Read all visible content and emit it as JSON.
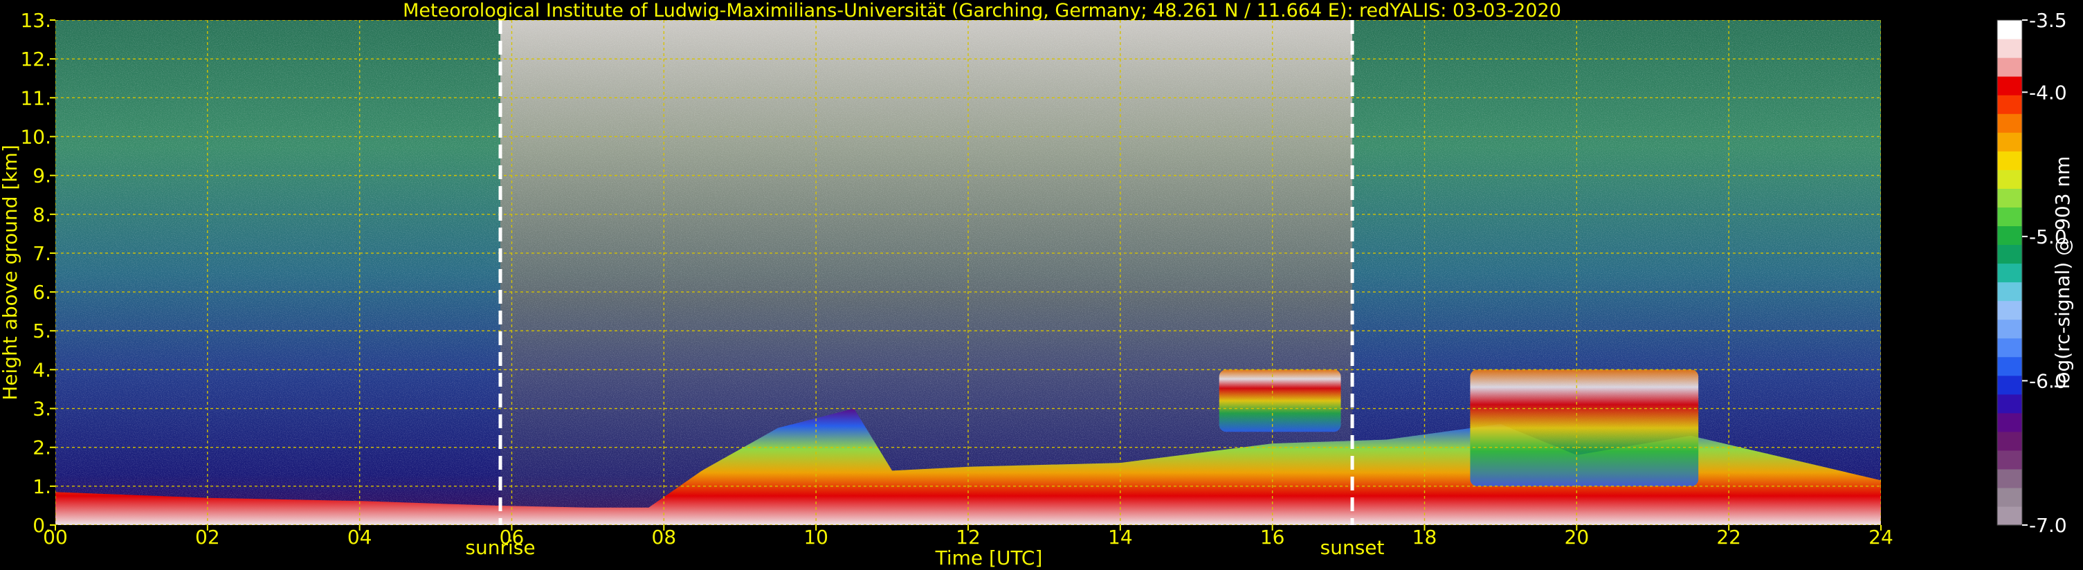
{
  "colors": {
    "background": "#000000",
    "text_yellow": "#f5f500",
    "grid": "#d6c200",
    "marker_line": "#ffffff"
  },
  "chart_data": {
    "type": "heatmap",
    "title": "Meteorological Institute of Ludwig-Maximilians-Universität (Garching, Germany; 48.261 N / 11.664 E):    redYALIS: 03-03-2020",
    "xlabel": "Time [UTC]",
    "ylabel": "Height above ground [km]",
    "xlim": [
      0,
      24
    ],
    "ylim": [
      0,
      13
    ],
    "xticks": [
      0,
      2,
      4,
      6,
      8,
      10,
      12,
      14,
      16,
      18,
      20,
      22,
      24
    ],
    "xtick_labels": [
      "00",
      "02",
      "04",
      "06",
      "08",
      "10",
      "12",
      "14",
      "16",
      "18",
      "20",
      "22",
      "24"
    ],
    "yticks": [
      0,
      1,
      2,
      3,
      4,
      5,
      6,
      7,
      8,
      9,
      10,
      11,
      12,
      13
    ],
    "ytick_labels": [
      "0.",
      "1.",
      "2.",
      "3.",
      "4.",
      "5.",
      "6.",
      "7.",
      "8.",
      "9.",
      "10.",
      "11.",
      "12.",
      "13."
    ],
    "grid": true,
    "markers": [
      {
        "label": "sunrise",
        "x": 5.85
      },
      {
        "label": "sunset",
        "x": 17.05
      }
    ],
    "colorbar": {
      "label": "log(rc-signal) @ 903 nm",
      "range": [
        -7.0,
        -3.5
      ],
      "ticks": [
        -7.0,
        -6.0,
        -5.0,
        -4.0,
        -3.5
      ],
      "tick_labels": [
        "-7.0",
        "-6.0",
        "-5.0",
        "-4.0",
        "-3.5"
      ],
      "colors": [
        "#a898a8",
        "#988898",
        "#886888",
        "#783878",
        "#6a1a70",
        "#5a0a88",
        "#3010b0",
        "#1830d8",
        "#2860f0",
        "#5088f8",
        "#78a8f8",
        "#98c0f8",
        "#68c8e0",
        "#20b8a0",
        "#10a060",
        "#20b040",
        "#58d040",
        "#98e040",
        "#d8e820",
        "#f8d800",
        "#f8a800",
        "#f87800",
        "#f83800",
        "#e80000",
        "#f0a0a0",
        "#f8d8d8",
        "#ffffff"
      ]
    },
    "features": {
      "boundary_layer_height_km": [
        {
          "t": 0.0,
          "h": 0.85
        },
        {
          "t": 2.0,
          "h": 0.7
        },
        {
          "t": 4.0,
          "h": 0.62
        },
        {
          "t": 5.8,
          "h": 0.5
        },
        {
          "t": 7.0,
          "h": 0.45
        },
        {
          "t": 7.8,
          "h": 0.45
        },
        {
          "t": 8.5,
          "h": 1.4
        },
        {
          "t": 9.5,
          "h": 2.5
        },
        {
          "t": 10.5,
          "h": 3.0
        },
        {
          "t": 11.0,
          "h": 1.4
        },
        {
          "t": 12.0,
          "h": 1.5
        },
        {
          "t": 14.0,
          "h": 1.6
        },
        {
          "t": 16.0,
          "h": 2.1
        },
        {
          "t": 17.5,
          "h": 2.2
        },
        {
          "t": 19.0,
          "h": 2.6
        },
        {
          "t": 20.0,
          "h": 1.8
        },
        {
          "t": 21.5,
          "h": 2.3
        }
      ],
      "cloud_patch_time_ranges_h": [
        {
          "t0": 15.3,
          "t1": 16.9,
          "h0": 2.4,
          "h1": 4.0
        },
        {
          "t0": 18.6,
          "t1": 21.6,
          "h0": 1.0,
          "h1": 4.0
        }
      ]
    }
  }
}
